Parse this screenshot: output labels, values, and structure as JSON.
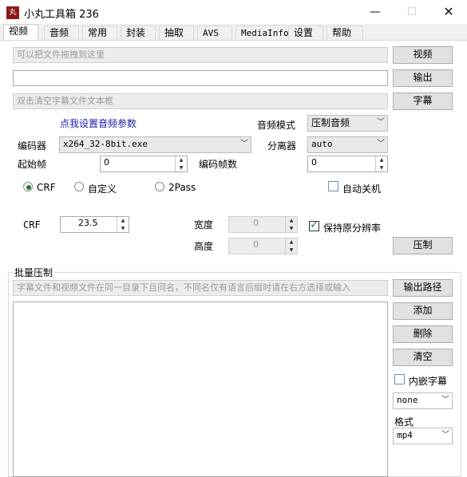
{
  "window": {
    "title": "小丸工具箱 236",
    "icon_text": "丸"
  },
  "tabs": [
    "视频",
    "音频",
    "常用",
    "封装",
    "抽取",
    "AVS",
    "MediaInfo",
    "设置",
    "帮助"
  ],
  "video": {
    "video_input_placeholder": "可以把文件拖拽到这里",
    "video_button": "视频",
    "output_value": "",
    "output_button": "输出",
    "subtitle_placeholder": "双击清空字幕文件文本框",
    "subtitle_button": "字幕",
    "audio_params_link": "点我设置音频参数",
    "audio_mode_label": "音频模式",
    "audio_mode_value": "压制音频",
    "encoder_label": "编码器",
    "encoder_value": "x264_32-8bit.exe",
    "demuxer_label": "分离器",
    "demuxer_value": "auto",
    "start_frame_label": "起始帧",
    "start_frame_value": "0",
    "encode_frames_label": "编码帧数",
    "encode_frames_value": "0",
    "radio_crf": "CRF",
    "radio_custom": "自定义",
    "radio_2pass": "2Pass",
    "auto_shutdown": "自动关机",
    "crf_label": "CRF",
    "crf_value": "23.5",
    "width_label": "宽度",
    "width_value": "0",
    "height_label": "高度",
    "height_value": "0",
    "keep_resolution": "保持原分辨率",
    "encode_button": "压制"
  },
  "batch": {
    "group_title": "批量压制",
    "hint": "字幕文件和视频文件在同一目录下且同名，不同名仅有语言后缀时请在右方选择或输入",
    "output_path_button": "输出路径",
    "add_button": "添加",
    "delete_button": "删除",
    "clear_button": "清空",
    "embed_subtitle": "内嵌字幕",
    "subtitle_lang_value": "none",
    "format_label": "格式",
    "format_value": "mp4"
  },
  "colors": {
    "accent_green": "#2d7b2d",
    "link": "#1a1aa6",
    "app_icon": "#8b1a1a"
  }
}
